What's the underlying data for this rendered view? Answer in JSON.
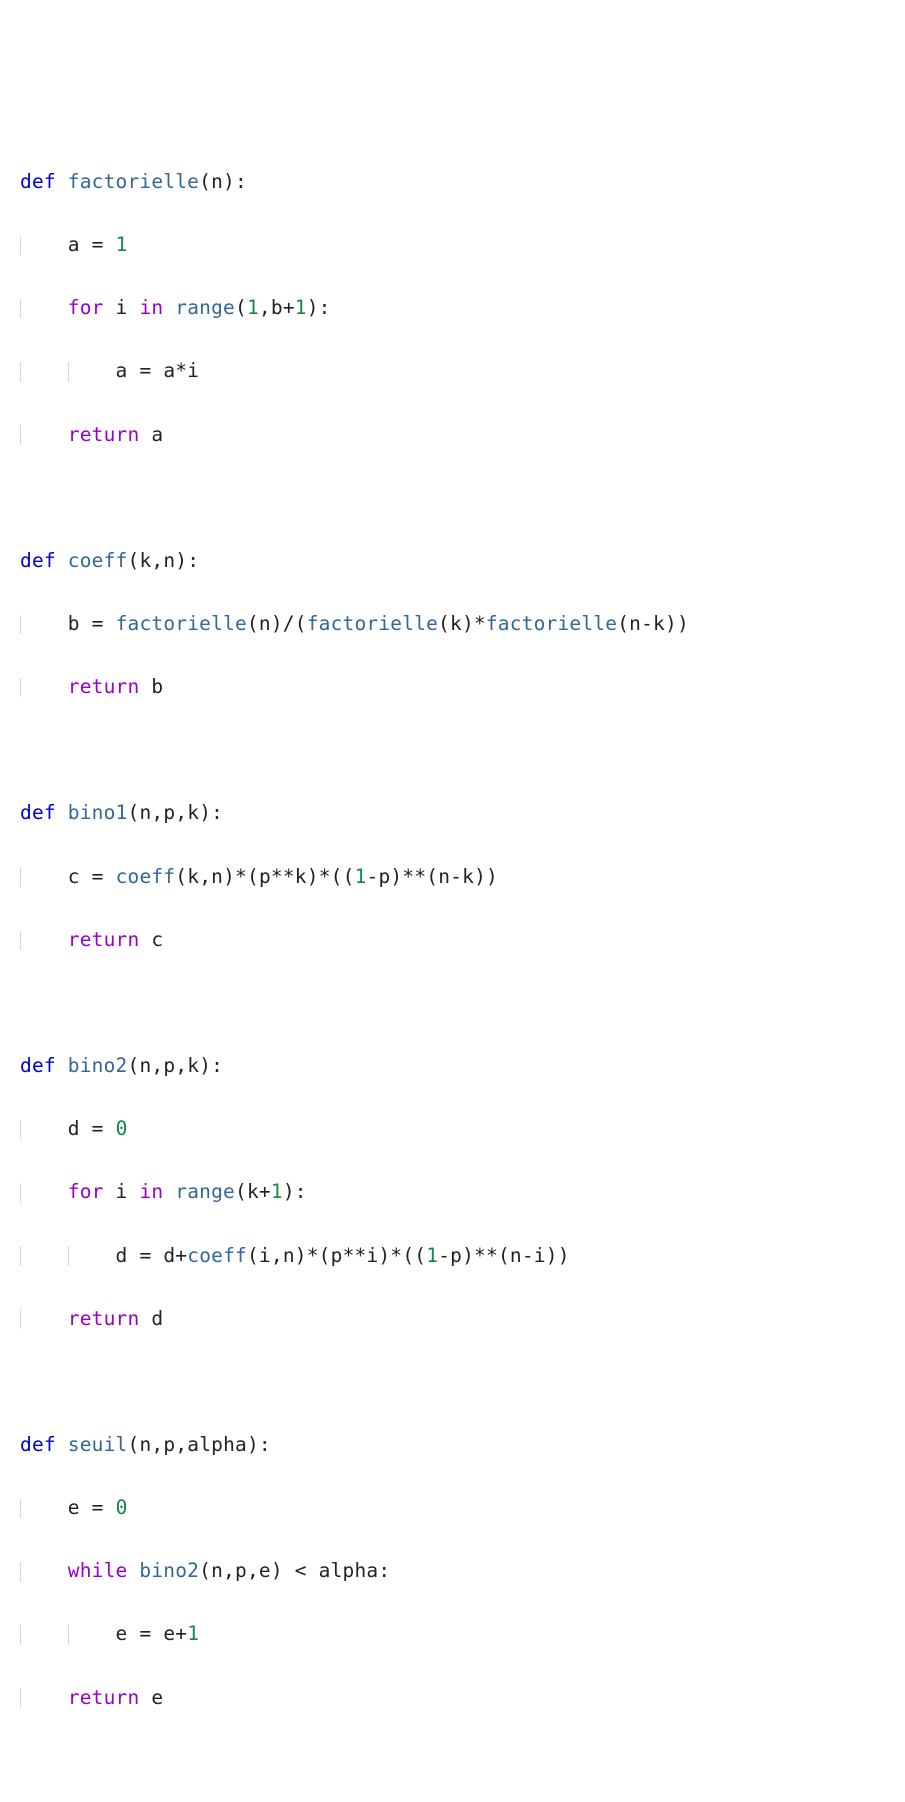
{
  "keywords": {
    "def": "def",
    "for": "for",
    "in": "in",
    "return": "return",
    "while": "while"
  },
  "fn_names": {
    "factorielle": "factorielle",
    "coeff": "coeff",
    "bino1": "bino1",
    "bino2": "bino2",
    "seuil": "seuil",
    "range": "range"
  },
  "ids": {
    "n": "n",
    "k": "k",
    "p": "p",
    "a": "a",
    "b": "b",
    "c": "c",
    "d": "d",
    "e": "e",
    "i": "i",
    "alpha": "alpha"
  },
  "nums": {
    "zero": "0",
    "one": "1"
  },
  "ops": {
    "lparen": "(",
    "rparen": ")",
    "colon": ":",
    "comma": ",",
    "eq": "=",
    "plus": "+",
    "minus": "-",
    "star": "*",
    "dstar": "**",
    "slash": "/",
    "lt": "<"
  }
}
